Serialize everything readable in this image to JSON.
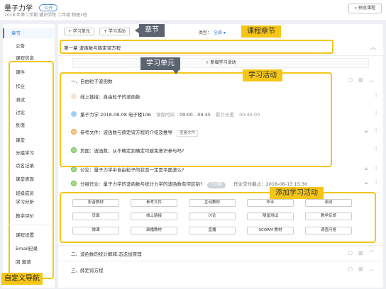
{
  "header": {
    "course_title": "量子力学",
    "course_tag": "公开",
    "course_meta": "2018 年第二学期 通识学院 二年级 物理1班",
    "preview_button": "预览课程"
  },
  "sidebar": {
    "active_item": "章节",
    "items": [
      "公告",
      "课程信息",
      "课件",
      "作业",
      "测试",
      "讨论",
      "反馈",
      "课堂",
      "分组学习",
      "点名记录",
      "课堂表现",
      "班级成员",
      "学习分析",
      "教学评价"
    ],
    "extra_items": [
      "课程设置",
      "Email纪录",
      "回 邀请"
    ]
  },
  "toolbar": {
    "add_unit": "+ 学习单元",
    "add_activity": "+ 学习活动",
    "type_label": "类型：",
    "type_value": "全部 ▾"
  },
  "annotations": {
    "chapter_tip": "章节",
    "course_chapter": "课程章节",
    "unit_tip": "学习单元",
    "activity_label": "学习活动",
    "add_activity_label": "添加学习活动",
    "custom_nav": "自定义导航"
  },
  "chapter": {
    "title": "第一章 波函数与薛定谔方程",
    "toggle": "︿",
    "add_unit_text": "新增学习活动"
  },
  "unit1": {
    "title": "一、自由粒子波函数",
    "controls": "▢ ▥ ︿",
    "activities": [
      {
        "text": "线上链接：自由粒子的波函数"
      },
      {
        "text": "量子力学 2018-08-08 电子楼106",
        "extra1": "课程时间",
        "extra2": "09:00 - 09:45",
        "extra3": "影片长度",
        "extra4": "00:46:00"
      },
      {
        "text": "参考文件：波函数与薛定谔方程的介绍及推导",
        "chip": "查看文件"
      },
      {
        "text": "页面：波函数，从不确定到确定可避免意识参与吗?"
      }
    ],
    "discussion": "讨论：量子力学中自由粒子的状态一定是平面波么?",
    "assignment": "分组作业：量子力学的波函数与统计力学的波函数有何区别?",
    "assignment_status": "已过期",
    "assignment_due": "作业交付截止：2018-08-13 15:30"
  },
  "add_activity_grid": [
    [
      "影音教材",
      "参考文件",
      "互动教材",
      "作业",
      "测试"
    ],
    [
      "页面",
      "线上链接",
      "讨论",
      "随堂测试",
      "教学反馈"
    ],
    [
      "微课",
      "录播教材",
      "直播",
      "SCORM 教材",
      "调查问卷"
    ]
  ],
  "unit2": {
    "title": "二、波函数的统计解释,态迭加原理",
    "controls": "▢ ▥ ﹀"
  },
  "unit3": {
    "title": "三、薛定谔方程",
    "controls": "▢ ▥ ︿"
  }
}
